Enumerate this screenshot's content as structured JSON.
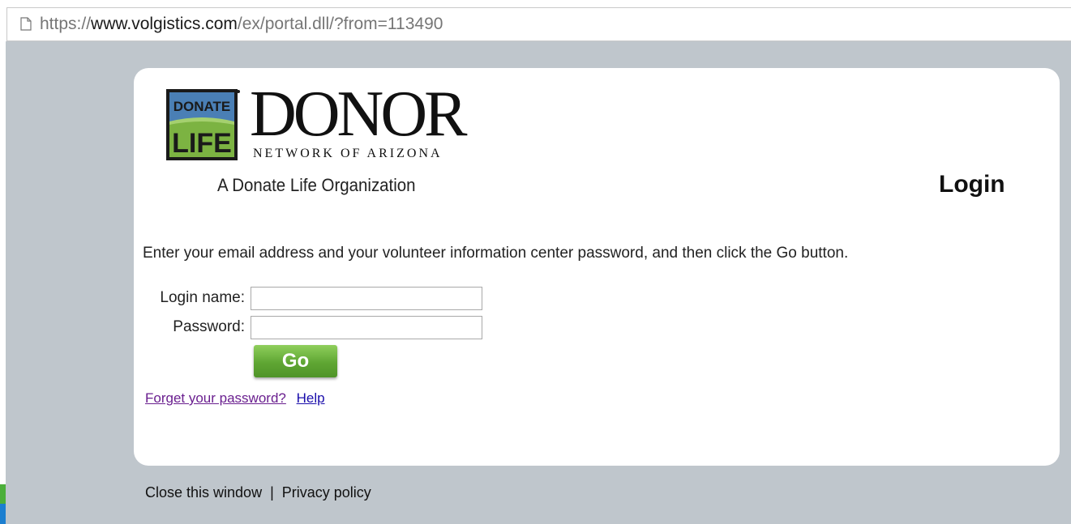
{
  "browser": {
    "url_prefix": "https://",
    "url_host": "www.volgistics.com",
    "url_path": "/ex/portal.dll/?from=113490"
  },
  "logo": {
    "badge_top": "DONATE",
    "badge_bottom": "LIFE",
    "wordmark": "DONOR",
    "subtitle": "NETWORK OF ARIZONA",
    "tagline": "A Donate Life Organization"
  },
  "page": {
    "title": "Login",
    "instructions": "Enter your email address and your volunteer information center password, and then click the Go button."
  },
  "form": {
    "login_label": "Login name:",
    "login_value": "",
    "password_label": "Password:",
    "password_value": "",
    "go_label": "Go"
  },
  "links": {
    "forgot": "Forget your password?",
    "help": "Help"
  },
  "footer": {
    "close": "Close this window",
    "separator": "|",
    "privacy": "Privacy policy"
  },
  "colors": {
    "background": "#bfc6cc",
    "go_button": "#5fa633",
    "logo_blue": "#4a7fb5",
    "logo_green": "#7cb342"
  }
}
